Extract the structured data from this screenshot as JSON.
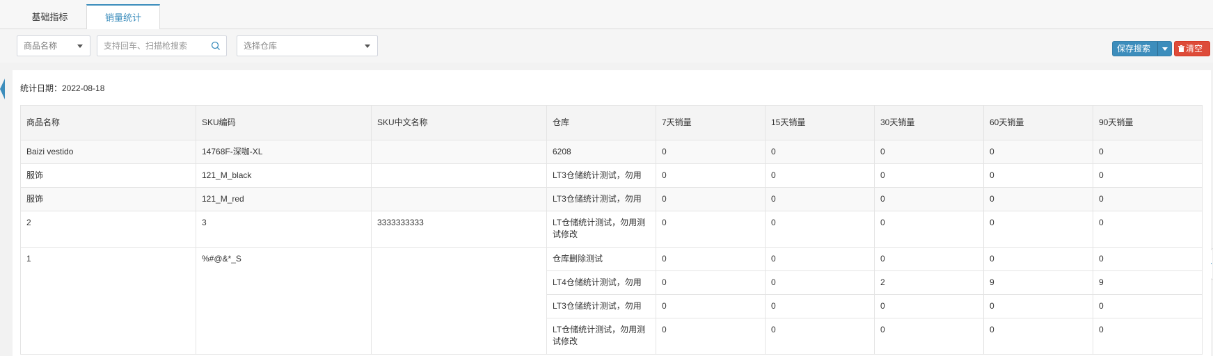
{
  "tabs": [
    {
      "label": "基础指标"
    },
    {
      "label": "销量统计"
    }
  ],
  "filters": {
    "product_select": "商品名称",
    "search_placeholder": "支持回车、扫描枪搜索",
    "warehouse_select": "选择仓库"
  },
  "buttons": {
    "save_search": "保存搜索",
    "clear": "清空"
  },
  "stat_date": "统计日期：2022-08-18",
  "table": {
    "headers": [
      "商品名称",
      "SKU编码",
      "SKU中文名称",
      "仓库",
      "7天销量",
      "15天销量",
      "30天销量",
      "60天销量",
      "90天销量"
    ],
    "rows": [
      [
        "Baizi vestido",
        "14768F-深咖-XL",
        "",
        "6208",
        "0",
        "0",
        "0",
        "0",
        "0"
      ],
      [
        "服饰",
        "121_M_black",
        "",
        "LT3仓储统计测试，勿用",
        "0",
        "0",
        "0",
        "0",
        "0"
      ],
      [
        "服饰",
        "121_M_red",
        "",
        "LT3仓储统计测试，勿用",
        "0",
        "0",
        "0",
        "0",
        "0"
      ],
      [
        "2",
        "3",
        "3333333333",
        "LT仓储统计测试，勿用测试修改",
        "0",
        "0",
        "0",
        "0",
        "0"
      ],
      [
        "1",
        "%#@&*_S",
        "",
        "仓库删除测试",
        "0",
        "0",
        "0",
        "0",
        "0"
      ]
    ],
    "grouped_rows": [
      [
        "LT4仓储统计测试，勿用",
        "0",
        "0",
        "2",
        "9",
        "9"
      ],
      [
        "LT3仓储统计测试，勿用",
        "0",
        "0",
        "0",
        "0",
        "0"
      ],
      [
        "LT仓储统计测试，勿用测试修改",
        "0",
        "0",
        "0",
        "0",
        "0"
      ]
    ]
  },
  "colors": {
    "accent": "#3c8dbc",
    "danger": "#dd4b39"
  }
}
